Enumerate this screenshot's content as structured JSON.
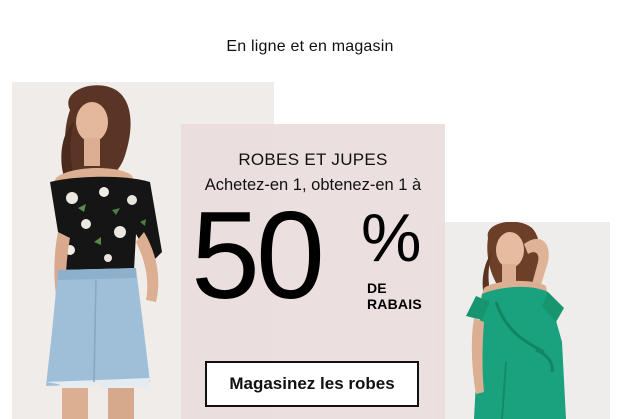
{
  "banner": {
    "availability": "En ligne et en magasin",
    "category": "ROBES ET JUPES",
    "offer": "Achetez-en 1, obtenez-en 1 à",
    "discount_number": "50",
    "discount_symbol": "%",
    "discount_word_1": "DE",
    "discount_word_2": "RABAIS",
    "cta_label": "Magasinez les robes"
  },
  "colors": {
    "promo_background": "#e9ddde",
    "text": "#111111",
    "button_background": "#ffffff",
    "button_border": "#111111",
    "green_dress": "#1aa27e",
    "floral_top": "#151515",
    "denim": "#9fbfd8"
  }
}
